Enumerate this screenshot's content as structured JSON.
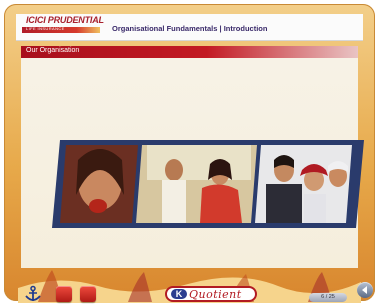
{
  "header": {
    "logo_brand": "ICICI PRUDENTIAL",
    "logo_tagline": "LIFE INSURANCE",
    "title": "Organisational Fundamentals | Introduction"
  },
  "section": {
    "title": "Our Organisation"
  },
  "footer": {
    "brand_mark": "K",
    "brand_word": "Quotient",
    "page_indicator": "6 / 25"
  },
  "colors": {
    "frame_orange": "#e7a94a",
    "title_red": "#b11a22",
    "header_text": "#3a2a6a",
    "photo_frame_blue": "#2a3b6c"
  }
}
